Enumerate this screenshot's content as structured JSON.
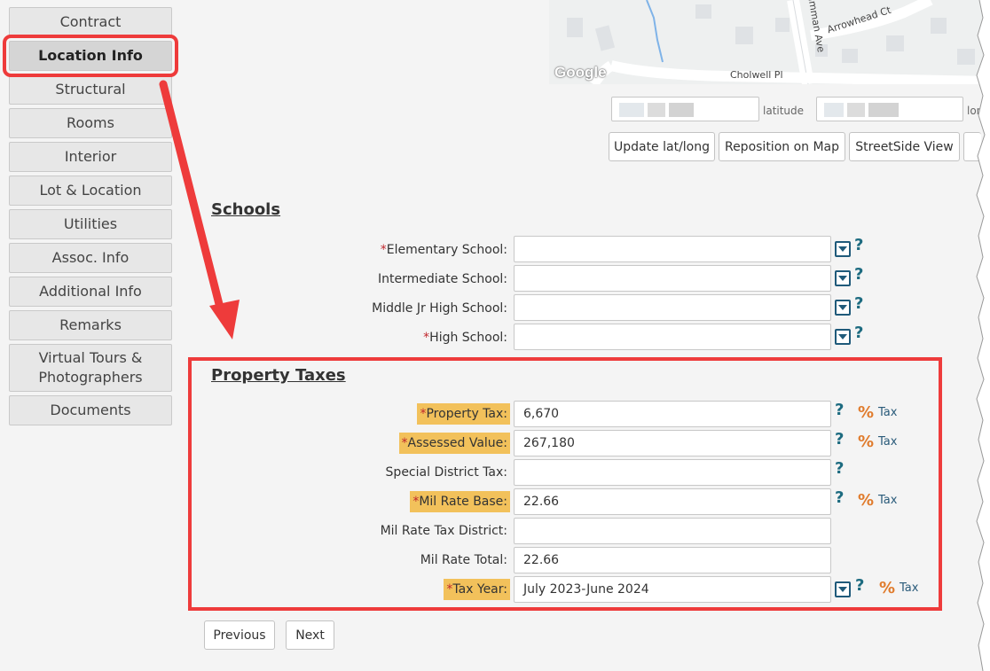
{
  "sidebar": {
    "items": [
      {
        "label": "Contract",
        "active": false
      },
      {
        "label": "Location Info",
        "active": true
      },
      {
        "label": "Structural",
        "active": false
      },
      {
        "label": "Rooms",
        "active": false
      },
      {
        "label": "Interior",
        "active": false
      },
      {
        "label": "Lot & Location",
        "active": false
      },
      {
        "label": "Utilities",
        "active": false
      },
      {
        "label": "Assoc. Info",
        "active": false
      },
      {
        "label": "Additional Info",
        "active": false
      },
      {
        "label": "Remarks",
        "active": false
      },
      {
        "label": "Virtual Tours & Photographers",
        "active": false
      },
      {
        "label": "Documents",
        "active": false
      }
    ]
  },
  "map": {
    "logo": "Google",
    "streets": [
      "Arrowhead Ct",
      "Cholwell Pl",
      "umman Ave"
    ]
  },
  "coordinates": {
    "latitude_label": "latitude",
    "longitude_label": "lon"
  },
  "map_tools": {
    "update": "Update lat/long",
    "reposition": "Reposition on Map",
    "streetside": "StreetSide View"
  },
  "schools": {
    "title": "Schools",
    "fields": [
      {
        "label": "Elementary School:",
        "required": true,
        "value": ""
      },
      {
        "label": "Intermediate School:",
        "required": false,
        "value": ""
      },
      {
        "label": "Middle Jr High School:",
        "required": false,
        "value": ""
      },
      {
        "label": "High School:",
        "required": true,
        "value": ""
      }
    ]
  },
  "taxes": {
    "title": "Property Taxes",
    "tax_link": "Tax",
    "fields": [
      {
        "label": "Property Tax:",
        "required": true,
        "value": "6,670"
      },
      {
        "label": "Assessed Value:",
        "required": true,
        "value": "267,180"
      },
      {
        "label": "Special District Tax:",
        "required": false,
        "value": ""
      },
      {
        "label": "Mil Rate Base:",
        "required": true,
        "value": "22.66"
      },
      {
        "label": "Mil Rate Tax District:",
        "required": false,
        "value": ""
      },
      {
        "label": "Mil Rate Total:",
        "required": false,
        "value": "22.66"
      },
      {
        "label": "Tax Year:",
        "required": true,
        "value": "July 2023-June 2024"
      }
    ]
  },
  "nav": {
    "previous": "Previous",
    "next": "Next"
  },
  "icons": {
    "required_marker": "*",
    "help": "?",
    "percent": "%"
  },
  "colors": {
    "highlight_red": "#ee3b3b",
    "required_label_bg": "#f2c15b",
    "help_icon": "#1d6b80",
    "percent_icon": "#e07b2c"
  }
}
